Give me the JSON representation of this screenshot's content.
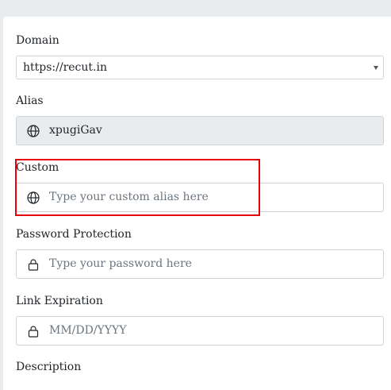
{
  "domain": {
    "label": "Domain",
    "value": "https://recut.in"
  },
  "alias": {
    "label": "Alias",
    "value": "xpugiGav",
    "icon": "globe-icon"
  },
  "custom": {
    "label": "Custom",
    "placeholder": "Type your custom alias here",
    "icon": "globe-icon"
  },
  "password": {
    "label": "Password Protection",
    "placeholder": "Type your password here",
    "icon": "lock-icon"
  },
  "expiration": {
    "label": "Link Expiration",
    "placeholder": "MM/DD/YYYY",
    "icon": "lock-icon"
  },
  "description": {
    "label": "Description"
  },
  "colors": {
    "highlight": "#e8000b",
    "readonly_background": "#e9ecef",
    "border": "#ced4da"
  }
}
